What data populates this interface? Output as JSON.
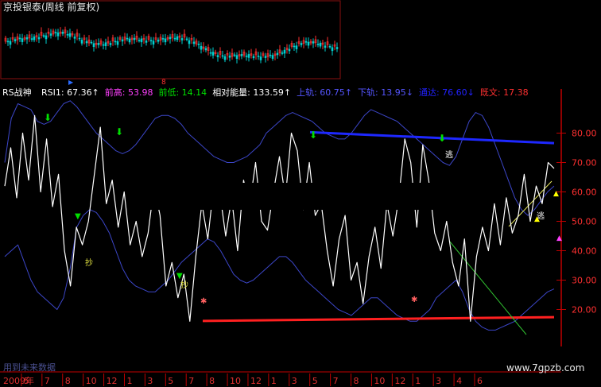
{
  "window": {
    "title": "京投银泰(周线 前复权)"
  },
  "indicator_header": {
    "name": "RS战神",
    "items": [
      {
        "label": "RSI1:",
        "value": "67.36",
        "arrow": "↑",
        "color": "#ffffff"
      },
      {
        "label": "前高:",
        "value": "53.98",
        "arrow": "",
        "color": "#ff40ff"
      },
      {
        "label": "前低:",
        "value": "14.14",
        "arrow": "",
        "color": "#00e000"
      },
      {
        "label": "相对能量:",
        "value": "133.59",
        "arrow": "↑",
        "color": "#ffffff"
      },
      {
        "label": "上轨:",
        "value": "60.75",
        "arrow": "↑",
        "color": "#5555ff"
      },
      {
        "label": "下轨:",
        "value": "13.95",
        "arrow": "↓",
        "color": "#5555ff"
      },
      {
        "label": "通达:",
        "value": "76.60",
        "arrow": "↓",
        "color": "#2222ff"
      },
      {
        "label": "既文:",
        "value": "17.38",
        "arrow": "",
        "color": "#ff3030"
      }
    ]
  },
  "y_axis_ticks": [
    "80.00",
    "70.00",
    "60.00",
    "50.00",
    "40.00",
    "30.00",
    "20.00"
  ],
  "x_axis": {
    "labels": [
      "2009年",
      "5",
      "7",
      "8",
      "10",
      "12",
      "1",
      "3",
      "5",
      "7",
      "8",
      "10",
      "12",
      "1",
      "3",
      "5",
      "7",
      "8",
      "10",
      "12",
      "1",
      "3",
      "4",
      "6"
    ]
  },
  "annotations": {
    "escape_labels": [
      "逃",
      "逃"
    ],
    "buy_labels": [
      "抄",
      "抄"
    ],
    "future_data_note": "用到未来数据"
  },
  "watermark": "www.7gpzb.com",
  "colors": {
    "background": "#000000",
    "rsi_line": "#ffffff",
    "band_lines": "#3c46c8",
    "resistance_line": "#1e28ff",
    "support_line": "#ff2020",
    "axis_red": "#c00000",
    "candle_up": "#ff3030",
    "candle_down": "#00d0d0",
    "down_arrow": "#00e000"
  },
  "chart_data": {
    "type": "line",
    "title": "RS战神",
    "xlabel": "",
    "ylabel": "",
    "ylim": [
      5,
      95
    ],
    "series": [
      {
        "name": "RSI1",
        "values": [
          62,
          75,
          58,
          80,
          64,
          86,
          60,
          78,
          55,
          66,
          40,
          28,
          48,
          42,
          50,
          66,
          82,
          56,
          64,
          48,
          60,
          42,
          50,
          38,
          46,
          62,
          52,
          28,
          36,
          24,
          32,
          16,
          38,
          56,
          44,
          62,
          60,
          45,
          58,
          40,
          64,
          55,
          70,
          50,
          47,
          60,
          72,
          58,
          80,
          74,
          54,
          70,
          52,
          56,
          40,
          28,
          44,
          52,
          30,
          36,
          22,
          38,
          48,
          34,
          56,
          45,
          58,
          78,
          70,
          48,
          76,
          64,
          46,
          40,
          50,
          36,
          28,
          44,
          16,
          38,
          48,
          40,
          56,
          42,
          58,
          46,
          52,
          66,
          50,
          62,
          56,
          70,
          68
        ]
      },
      {
        "name": "上轨",
        "values": [
          70,
          85,
          90,
          89,
          88,
          84,
          83,
          84,
          87,
          90,
          91,
          89,
          86,
          83,
          80,
          78,
          76,
          74,
          73,
          74,
          76,
          79,
          82,
          85,
          86,
          86,
          85,
          83,
          80,
          78,
          76,
          74,
          72,
          71,
          70,
          70,
          71,
          72,
          74,
          76,
          80,
          82,
          84,
          86,
          87,
          86,
          85,
          84,
          82,
          80,
          79,
          78,
          78,
          80,
          83,
          86,
          88,
          87,
          86,
          85,
          84,
          82,
          80,
          78,
          76,
          74,
          72,
          70,
          69,
          72,
          78,
          84,
          87,
          86,
          82,
          76,
          70,
          64,
          58,
          54,
          52,
          54,
          57,
          60,
          62
        ]
      },
      {
        "name": "下轨",
        "values": [
          38,
          40,
          42,
          36,
          30,
          26,
          24,
          22,
          20,
          24,
          34,
          48,
          52,
          54,
          53,
          50,
          46,
          40,
          34,
          30,
          28,
          27,
          26,
          26,
          28,
          30,
          33,
          36,
          38,
          40,
          42,
          44,
          43,
          40,
          36,
          32,
          30,
          29,
          30,
          32,
          34,
          36,
          38,
          38,
          36,
          33,
          30,
          28,
          26,
          24,
          22,
          20,
          19,
          18,
          20,
          22,
          24,
          24,
          22,
          20,
          18,
          17,
          16,
          16,
          18,
          20,
          24,
          26,
          28,
          30,
          26,
          20,
          16,
          14,
          13,
          13,
          14,
          15,
          16,
          18,
          20,
          22,
          24,
          26,
          27
        ]
      },
      {
        "name": "通达",
        "values": [
          80.3,
          76.6
        ]
      },
      {
        "name": "既文",
        "values": [
          16.1,
          17.4
        ]
      }
    ]
  }
}
